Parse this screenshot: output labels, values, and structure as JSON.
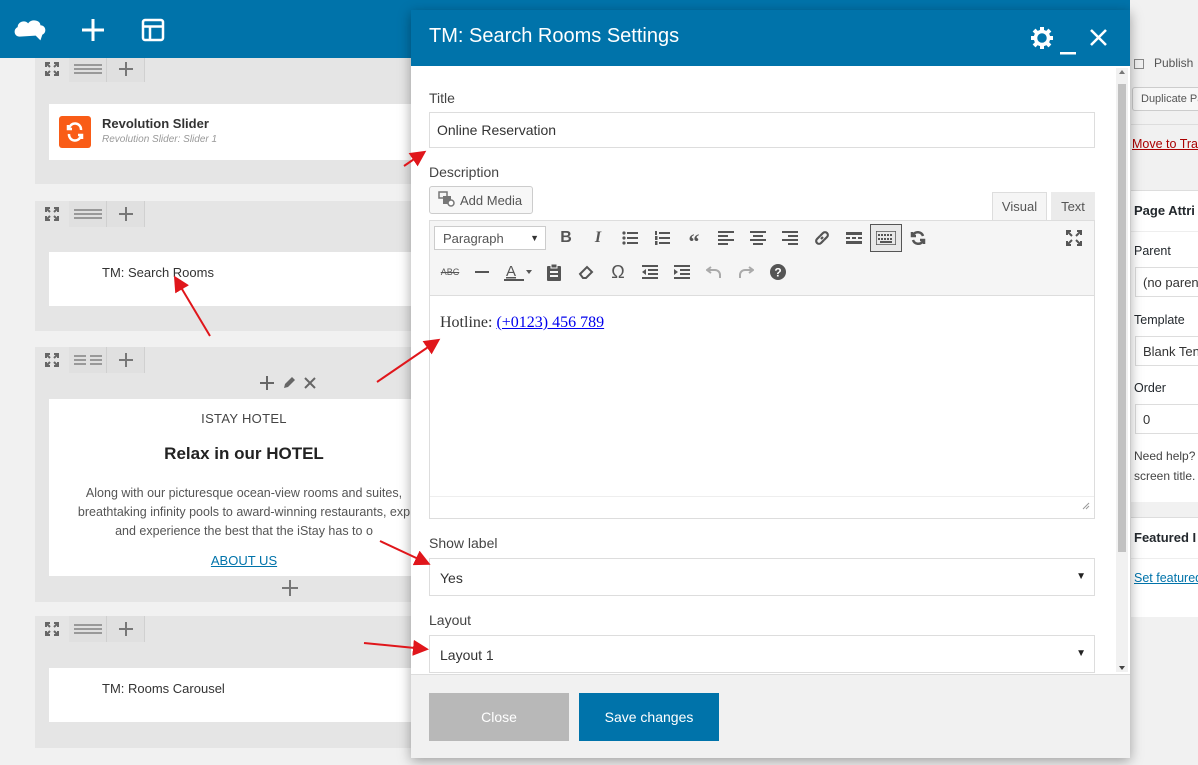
{
  "colors": {
    "accent": "#0073aa",
    "annotation": "#e0161b"
  },
  "topbar": {
    "icons": [
      "logo-cloud-icon",
      "plus-icon",
      "layout-icon",
      "fullscreen-icon"
    ]
  },
  "builder": {
    "rows": [
      {
        "module_title": "Revolution Slider",
        "module_sub": "Revolution Slider: Slider 1"
      },
      {
        "module_title": "TM: Search Rooms"
      },
      {
        "kicker": "ISTAY HOTEL",
        "heading": "Relax in our HOTEL",
        "body_lines": [
          "Along with our picturesque ocean-view rooms and suites,",
          "breathtaking infinity pools to award-winning restaurants, exp",
          "and experience the best that the iStay has to o"
        ],
        "link": "ABOUT US"
      },
      {
        "module_title": "TM: Rooms Carousel"
      }
    ]
  },
  "sidebar": {
    "publish": "Publish",
    "duplicate": "Duplicate Pa",
    "trash": "Move to Tra",
    "page_attr": "Page Attri",
    "parent_label": "Parent",
    "parent_value": "(no paren",
    "template_label": "Template",
    "template_value": "Blank Ten",
    "order_label": "Order",
    "order_value": "0",
    "help_1": "Need help?",
    "help_2": "screen title.",
    "featured": "Featured I",
    "set_featured": "Set featured"
  },
  "modal": {
    "title": "TM: Search Rooms Settings",
    "title_label": "Title",
    "title_value": "Online Reservation",
    "description_label": "Description",
    "add_media": "Add Media",
    "tab_visual": "Visual",
    "tab_text": "Text",
    "format_select": "Paragraph",
    "editor_prefix": "Hotline: ",
    "editor_link": "(+0123) 456 789",
    "show_label_label": "Show label",
    "show_label_value": "Yes",
    "layout_label": "Layout",
    "layout_value": "Layout 1",
    "close_button": "Close",
    "save_button": "Save changes"
  }
}
